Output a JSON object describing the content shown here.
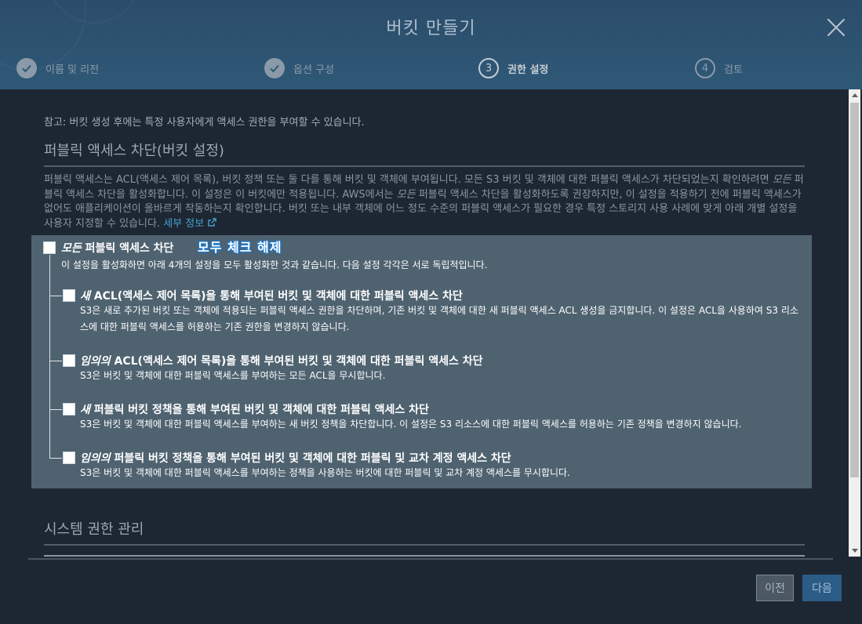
{
  "dialog": {
    "title": "버킷 만들기"
  },
  "steps": [
    {
      "number": "1",
      "label": "이름 및 리전",
      "state": "done"
    },
    {
      "number": "2",
      "label": "옵션 구성",
      "state": "done"
    },
    {
      "number": "3",
      "label": "권한 설정",
      "state": "current"
    },
    {
      "number": "4",
      "label": "검토",
      "state": "pending"
    }
  ],
  "note": "참고: 버킷 생성 후에는 특정 사용자에게 액세스 권한을 부여할 수 있습니다.",
  "public_access": {
    "heading": "퍼블릭 액세스 차단(버킷 설정)",
    "desc_part1": "퍼블릭 액세스는 ACL(액세스 제어 목록), 버킷 정책 또는 둘 다를 통해 버킷 및 객체에 부여됩니다. 모든 S3 버킷 및 객체에 대한 퍼블릭 액세스가 차단되었는지 확인하려면 ",
    "desc_em1": "모든",
    "desc_part2": " 퍼블릭 액세스 차단을 활성화합니다. 이 설정은 이 버킷에만 적용됩니다. AWS에서는 ",
    "desc_em2": "모든",
    "desc_part3": " 퍼블릭 액세스 차단을 활성화하도록 권장하지만, 이 설정을 적용하기 전에 퍼블릭 액세스가 없어도 애플리케이션이 올바르게 작동하는지 확인합니다. 버킷 또는 내부 객체에 어느 정도 수준의 퍼블릭 액세스가 필요한 경우 특정 스토리지 사용 사례에 맞게 아래 개별 설정을 사용자 지정할 수 있습니다.",
    "learn_more": "세부 정보",
    "block_all": {
      "label_em": "모든",
      "label_rest": " 퍼블릭 액세스 차단",
      "checked": false,
      "sub": "이 설정을 활성화하면 아래 4개의 설정을 모두 활성화한 것과 같습니다. 다음 설정 각각은 서로 독립적입니다."
    },
    "annotation": "모두 체크 해제",
    "items": [
      {
        "title_em": "새",
        "title_rest": " ACL(액세스 제어 목록)을 통해 부여된 버킷 및 객체에 대한 퍼블릭 액세스 차단",
        "desc": "S3은 새로 추가된 버킷 또는 객체에 적용되는 퍼블릭 액세스 권한을 차단하며, 기존 버킷 및 객체에 대한 새 퍼블릭 액세스 ACL 생성을 금지합니다. 이 설정은 ACL을 사용하여 S3 리소스에 대한 퍼블릭 액세스를 허용하는 기존 권한을 변경하지 않습니다.",
        "checked": false
      },
      {
        "title_em": "임의의",
        "title_rest": " ACL(액세스 제어 목록)을 통해 부여된 버킷 및 객체에 대한 퍼블릭 액세스 차단",
        "desc": "S3은 버킷 및 객체에 대한 퍼블릭 액세스를 부여하는 모든 ACL을 무시합니다.",
        "checked": false
      },
      {
        "title_em": "새",
        "title_rest": " 퍼블릭 버킷 정책을 통해 부여된 버킷 및 객체에 대한 퍼블릭 액세스 차단",
        "desc": "S3은 버킷 및 객체에 대한 퍼블릭 액세스를 부여하는 새 버킷 정책을 차단합니다. 이 설정은 S3 리소스에 대한 퍼블릭 액세스를 허용하는 기존 정책을 변경하지 않습니다.",
        "checked": false
      },
      {
        "title_em": "임의의",
        "title_rest": " 퍼블릭 버킷 정책을 통해 부여된 버킷 및 객체에 대한 퍼블릭 및 교차 계정 액세스 차단",
        "desc": "S3은 버킷 및 객체에 대한 퍼블릭 액세스를 부여하는 정책을 사용하는 버킷에 대한 퍼블릭 및 교차 계정 액세스를 무시합니다.",
        "checked": false
      }
    ]
  },
  "system_permissions": {
    "heading": "시스템 권한 관리"
  },
  "footer": {
    "prev_label": "이전",
    "next_label": "다음"
  },
  "colors": {
    "header_bg": "#2f5877",
    "panel_bg": "#4f6270",
    "link": "#44a0c8",
    "next_button": "#2b5c86"
  }
}
